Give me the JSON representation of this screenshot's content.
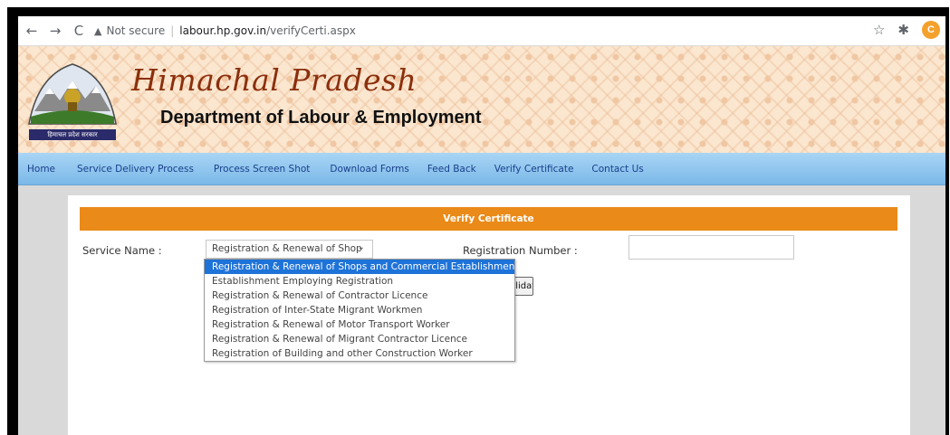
{
  "browser": {
    "back_icon": "←",
    "forward_icon": "→",
    "reload_icon": "C",
    "security_text": "Not secure",
    "url_host": "labour.hp.gov.in",
    "url_path": "/verifyCerti.aspx",
    "star_icon": "☆",
    "extension_icon": "✱",
    "profile_initial": "C"
  },
  "header": {
    "title": "Himachal Pradesh",
    "subtitle": "Department of Labour & Employment",
    "logo_caption": "हिमाचल प्रदेश सरकार"
  },
  "menu": {
    "items": [
      "Home",
      "Service Delivery Process",
      "Process Screen Shot",
      "Download Forms",
      "Feed Back",
      "Verify Certificate",
      "Contact Us"
    ]
  },
  "form": {
    "panel_title": "Verify Certificate",
    "service_label": "Service Name :",
    "service_selected": "Registration & Renewal of Shop",
    "registration_label": "Registration Number :",
    "registration_value": "",
    "validate_label": "Validate",
    "options": [
      "Registration & Renewal of Shops and Commercial Establishment",
      "Establishment Employing Registration",
      "Registration & Renewal of Contractor Licence",
      "Registration of Inter-State Migrant Workmen",
      "Registration & Renewal of Motor Transport Worker",
      "Registration & Renewal of Migrant Contractor Licence",
      "Registration of Building and other Construction Worker"
    ],
    "highlighted_option_index": 0
  },
  "colors": {
    "panel_header": "#ea8a18",
    "menubar": "#7ab8e8",
    "title_text": "#8b2f0c",
    "selected_option": "#1e73d8"
  }
}
